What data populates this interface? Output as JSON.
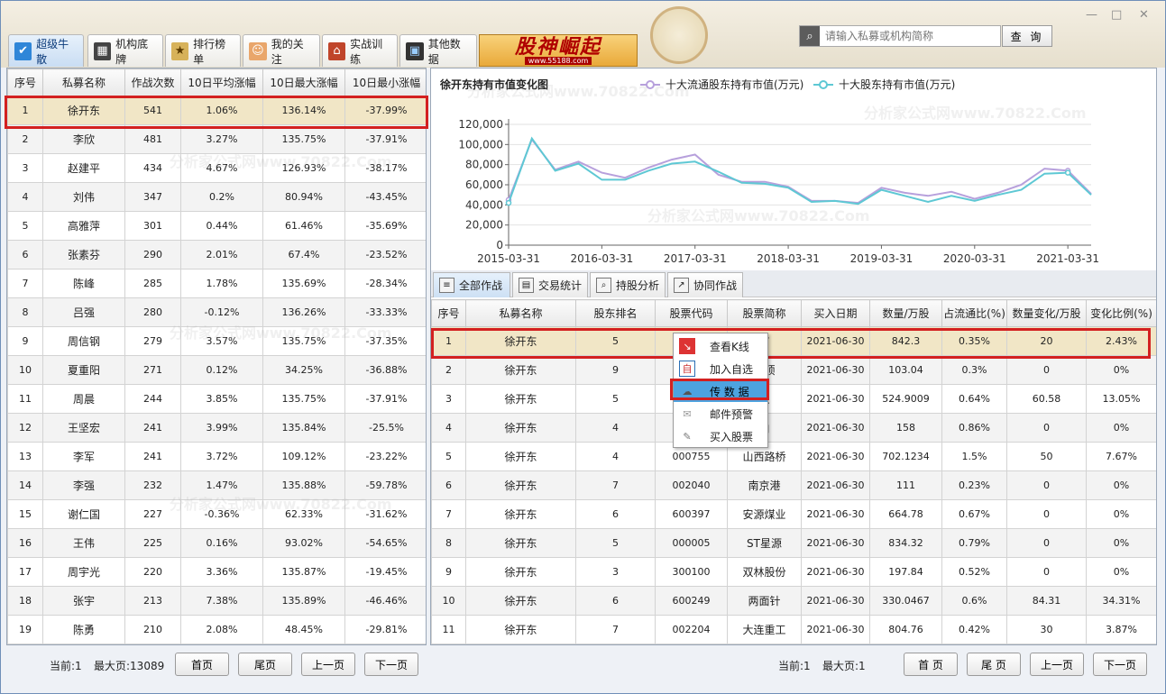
{
  "window": {
    "controls": [
      "—",
      "□",
      "✕"
    ]
  },
  "tabs": [
    {
      "label": "超级牛散",
      "icon": "checkmark-icon"
    },
    {
      "label": "机构底牌",
      "icon": "cards-icon"
    },
    {
      "label": "排行榜单",
      "icon": "ranking-icon"
    },
    {
      "label": "我的关注",
      "icon": "person-icon"
    },
    {
      "label": "实战训练",
      "icon": "house-icon"
    },
    {
      "label": "其他数据",
      "icon": "monitor-icon"
    }
  ],
  "banner": {
    "title": "股神崛起",
    "url": "www.55188.com"
  },
  "search": {
    "placeholder": "请输入私募或机构简称",
    "button": "查 询"
  },
  "left_table": {
    "columns": [
      "序号",
      "私募名称",
      "作战次数",
      "10日平均涨幅",
      "10日最大涨幅",
      "10日最小涨幅"
    ],
    "rows": [
      [
        "1",
        "徐开东",
        "541",
        "1.06%",
        "136.14%",
        "-37.99%"
      ],
      [
        "2",
        "李欣",
        "481",
        "3.27%",
        "135.75%",
        "-37.91%"
      ],
      [
        "3",
        "赵建平",
        "434",
        "4.67%",
        "126.93%",
        "-38.17%"
      ],
      [
        "4",
        "刘伟",
        "347",
        "0.2%",
        "80.94%",
        "-43.45%"
      ],
      [
        "5",
        "高雅萍",
        "301",
        "0.44%",
        "61.46%",
        "-35.69%"
      ],
      [
        "6",
        "张素芬",
        "290",
        "2.01%",
        "67.4%",
        "-23.52%"
      ],
      [
        "7",
        "陈峰",
        "285",
        "1.78%",
        "135.69%",
        "-28.34%"
      ],
      [
        "8",
        "吕强",
        "280",
        "-0.12%",
        "136.26%",
        "-33.33%"
      ],
      [
        "9",
        "周信钢",
        "279",
        "3.57%",
        "135.75%",
        "-37.35%"
      ],
      [
        "10",
        "夏重阳",
        "271",
        "0.12%",
        "34.25%",
        "-36.88%"
      ],
      [
        "11",
        "周晨",
        "244",
        "3.85%",
        "135.75%",
        "-37.91%"
      ],
      [
        "12",
        "王坚宏",
        "241",
        "3.99%",
        "135.84%",
        "-25.5%"
      ],
      [
        "13",
        "李军",
        "241",
        "3.72%",
        "109.12%",
        "-23.22%"
      ],
      [
        "14",
        "李强",
        "232",
        "1.47%",
        "135.88%",
        "-59.78%"
      ],
      [
        "15",
        "谢仁国",
        "227",
        "-0.36%",
        "62.33%",
        "-31.62%"
      ],
      [
        "16",
        "王伟",
        "225",
        "0.16%",
        "93.02%",
        "-54.65%"
      ],
      [
        "17",
        "周宇光",
        "220",
        "3.36%",
        "135.87%",
        "-19.45%"
      ],
      [
        "18",
        "张宇",
        "213",
        "7.38%",
        "135.89%",
        "-46.46%"
      ],
      [
        "19",
        "陈勇",
        "210",
        "2.08%",
        "48.45%",
        "-29.81%"
      ]
    ]
  },
  "left_pager": {
    "current": "当前:1",
    "max": "最大页:13089",
    "first": "首页",
    "last": "尾页",
    "prev": "上一页",
    "next": "下一页"
  },
  "chart_data": {
    "type": "line",
    "title": "徐开东持有市值变化图",
    "x": [
      "2015-03-31",
      "2015-06-30",
      "2015-09-30",
      "2015-12-31",
      "2016-03-31",
      "2016-06-30",
      "2016-09-30",
      "2016-12-31",
      "2017-03-31",
      "2017-06-30",
      "2017-09-30",
      "2017-12-31",
      "2018-03-31",
      "2018-06-30",
      "2018-09-30",
      "2018-12-31",
      "2019-03-31",
      "2019-06-30",
      "2019-09-30",
      "2019-12-31",
      "2020-03-31",
      "2020-06-30",
      "2020-09-30",
      "2020-12-31",
      "2021-03-31",
      "2021-06-30"
    ],
    "xticks": [
      "2015-03-31",
      "2016-03-31",
      "2017-03-31",
      "2018-03-31",
      "2019-03-31",
      "2020-03-31",
      "2021-03-31"
    ],
    "yticks": [
      "0",
      "20,000",
      "40,000",
      "60,000",
      "80,000",
      "100,000",
      "120,000"
    ],
    "ylim": [
      0,
      120000
    ],
    "series": [
      {
        "name": "十大流通股东持有市值(万元)",
        "color": "#b7a0dc",
        "values": [
          45000,
          105000,
          75000,
          83000,
          72000,
          67000,
          77000,
          85000,
          90000,
          70000,
          63000,
          63000,
          58000,
          44000,
          44000,
          42000,
          57000,
          52000,
          49000,
          53000,
          46000,
          52000,
          60000,
          76000,
          74000,
          51000
        ]
      },
      {
        "name": "十大股东持有市值(万元)",
        "color": "#5ec8d4",
        "values": [
          42000,
          106000,
          74000,
          81000,
          65000,
          65000,
          74000,
          81000,
          83000,
          73000,
          62000,
          61000,
          57000,
          43000,
          44000,
          41000,
          55000,
          49000,
          43000,
          49000,
          44000,
          50000,
          55000,
          71000,
          72000,
          50000
        ]
      }
    ]
  },
  "sub_tabs": [
    {
      "label": "全部作战",
      "icon": "list-icon"
    },
    {
      "label": "交易统计",
      "icon": "stats-icon"
    },
    {
      "label": "持股分析",
      "icon": "analysis-icon"
    },
    {
      "label": "协同作战",
      "icon": "chart-icon"
    }
  ],
  "right_table": {
    "columns": [
      "序号",
      "私募名称",
      "股东排名",
      "股票代码",
      "股票简称",
      "买入日期",
      "数量/万股",
      "占流通比(%)",
      "数量变化/万股",
      "变化比例(%)"
    ],
    "rows": [
      [
        "1",
        "徐开东",
        "5",
        "",
        "有",
        "2021-06-30",
        "842.3",
        "0.35%",
        "20",
        "2.43%"
      ],
      [
        "2",
        "徐开东",
        "9",
        "",
        "金顶",
        "2021-06-30",
        "103.04",
        "0.3%",
        "0",
        "0%"
      ],
      [
        "3",
        "徐开东",
        "5",
        "",
        "织",
        "2021-06-30",
        "524.9009",
        "0.64%",
        "60.58",
        "13.05%"
      ],
      [
        "4",
        "徐开东",
        "4",
        "",
        "山",
        "2021-06-30",
        "158",
        "0.86%",
        "0",
        "0%"
      ],
      [
        "5",
        "徐开东",
        "4",
        "000755",
        "山西路桥",
        "2021-06-30",
        "702.1234",
        "1.5%",
        "50",
        "7.67%"
      ],
      [
        "6",
        "徐开东",
        "7",
        "002040",
        "南京港",
        "2021-06-30",
        "111",
        "0.23%",
        "0",
        "0%"
      ],
      [
        "7",
        "徐开东",
        "6",
        "600397",
        "安源煤业",
        "2021-06-30",
        "664.78",
        "0.67%",
        "0",
        "0%"
      ],
      [
        "8",
        "徐开东",
        "5",
        "000005",
        "ST星源",
        "2021-06-30",
        "834.32",
        "0.79%",
        "0",
        "0%"
      ],
      [
        "9",
        "徐开东",
        "3",
        "300100",
        "双林股份",
        "2021-06-30",
        "197.84",
        "0.52%",
        "0",
        "0%"
      ],
      [
        "10",
        "徐开东",
        "6",
        "600249",
        "两面针",
        "2021-06-30",
        "330.0467",
        "0.6%",
        "84.31",
        "34.31%"
      ],
      [
        "11",
        "徐开东",
        "7",
        "002204",
        "大连重工",
        "2021-06-30",
        "804.76",
        "0.42%",
        "30",
        "3.87%"
      ]
    ]
  },
  "context_menu": [
    {
      "label": "查看K线",
      "icon": "kline-icon"
    },
    {
      "label": "加入自选",
      "icon": "add-favorite-icon"
    },
    {
      "label": "传 数 据",
      "icon": "upload-icon"
    },
    {
      "label": "邮件预警",
      "icon": "mail-icon"
    },
    {
      "label": "买入股票",
      "icon": "buy-icon"
    }
  ],
  "right_pager": {
    "current": "当前:1",
    "max": "最大页:1",
    "first": "首 页",
    "last": "尾 页",
    "prev": "上一页",
    "next": "下一页"
  },
  "watermark": "分析家公式网www.70822.Com"
}
